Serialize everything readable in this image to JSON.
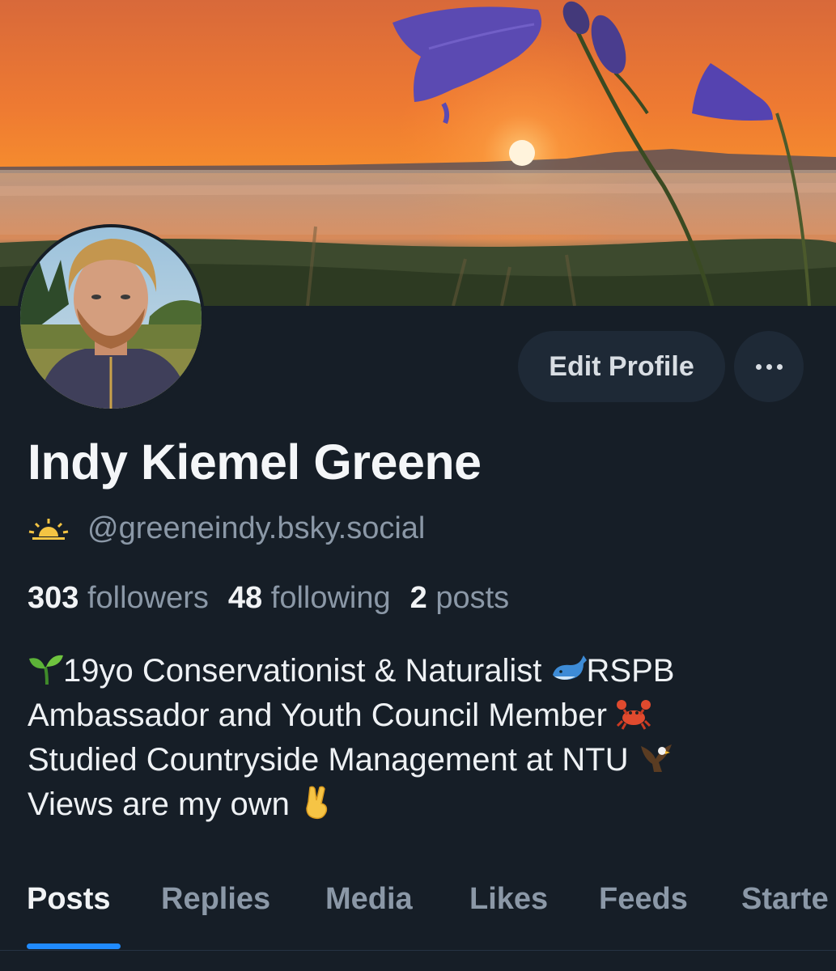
{
  "profile": {
    "display_name": "Indy Kiemel Greene",
    "handle": "@greeneindy.bsky.social",
    "handle_icon": "sunrise-icon"
  },
  "actions": {
    "edit_profile_label": "Edit Profile",
    "more_icon": "ellipsis-icon"
  },
  "stats": {
    "followers_count": "303",
    "followers_label": "followers",
    "following_count": "48",
    "following_label": "following",
    "posts_count": "2",
    "posts_label": "posts"
  },
  "bio": {
    "line1": "19yo Conservationist & Naturalist",
    "line1_end": "RSPB",
    "line2": "Ambassador and Youth Council Member",
    "line3": "Studied Countryside Management at NTU",
    "line4": "Views are my own",
    "emojis": [
      "seedling-icon",
      "whale-icon",
      "crab-icon",
      "eagle-icon",
      "victory-hand-icon"
    ]
  },
  "tabs": [
    {
      "label": "Posts",
      "active": true
    },
    {
      "label": "Replies",
      "active": false
    },
    {
      "label": "Media",
      "active": false
    },
    {
      "label": "Likes",
      "active": false
    },
    {
      "label": "Feeds",
      "active": false
    },
    {
      "label": "Starte",
      "active": false
    }
  ],
  "colors": {
    "background": "#161e27",
    "button_bg": "#1e2936",
    "muted_text": "#8b98a7",
    "accent": "#208bfe"
  }
}
